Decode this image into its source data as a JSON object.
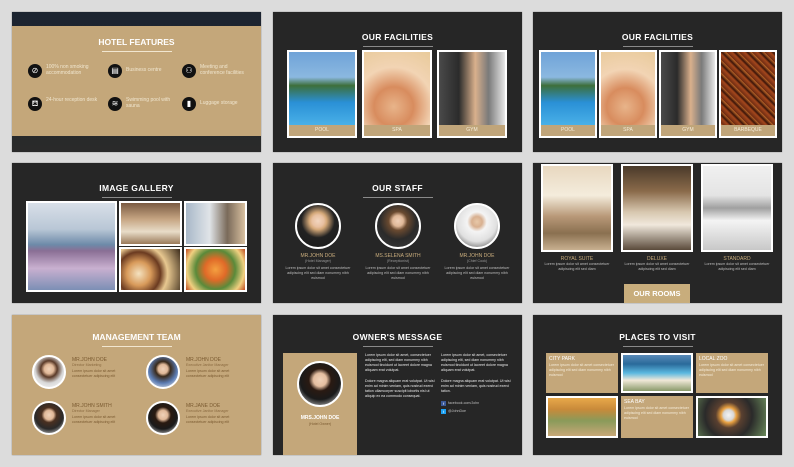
{
  "s1": {
    "title": "HOTEL FEATURES",
    "features": [
      {
        "icon": "no-smoking-icon",
        "glyph": "⊘",
        "label": "100% non smoking accommodation"
      },
      {
        "icon": "business-icon",
        "glyph": "▤",
        "label": "Business centre"
      },
      {
        "icon": "meeting-icon",
        "glyph": "⚇",
        "label": "Meeting and conference facilities"
      },
      {
        "icon": "reception-icon",
        "glyph": "⛾",
        "label": "24-hour reception desk"
      },
      {
        "icon": "pool-icon",
        "glyph": "≋",
        "label": "Swimming pool with sauna"
      },
      {
        "icon": "luggage-icon",
        "glyph": "▮",
        "label": "Luggage storage"
      }
    ]
  },
  "s2": {
    "title": "OUR FACILITIES",
    "items": [
      "POOL",
      "SPA",
      "GYM"
    ]
  },
  "s3": {
    "title": "OUR FACILITIES",
    "items": [
      "POOL",
      "SPA",
      "GYM",
      "BARBEQUE"
    ]
  },
  "s4": {
    "title": "IMAGE GALLERY"
  },
  "s5": {
    "title": "OUR STAFF",
    "staff": [
      {
        "name": "MR.JOHN DOE",
        "role": "(Hotel Manager)"
      },
      {
        "name": "MS.SELENA SMITH",
        "role": "(Receptionist)"
      },
      {
        "name": "MR.JOHN DOE",
        "role": "(Chief Cook)"
      }
    ],
    "desc": "Lorem ipsum dolor sit amet consectetuer adipiscing elit sed diam nonummy nibh euismod"
  },
  "s6": {
    "rooms": [
      "ROYAL SUITE",
      "DELUXE",
      "STANDARD"
    ],
    "desc": "Lorem ipsum dolor sit amet consectetuer adipiscing elit sed diam",
    "button": "OUR ROOMS"
  },
  "s7": {
    "title": "MANAGEMENT TEAM",
    "team": [
      {
        "name": "MR.JOHN DOE",
        "role": "Director Marketing"
      },
      {
        "name": "MR.JOHN DOE",
        "role": "Executive Janitor Manager"
      },
      {
        "name": "MR.JOHN SMITH",
        "role": "Director Manager"
      },
      {
        "name": "MR.JANE DOE",
        "role": "Executive Janitor Manager"
      }
    ],
    "desc": "Lorem ipsum dolor sit amet consectetuer adipiscing elit"
  },
  "s8": {
    "title": "OWNER'S MESSAGE",
    "name": "MRS.JOHN DOE",
    "role": "(Hotel Owner)",
    "p1": "Lorem ipsum dolor sit amet, consectetuer adipiscing elit, sed diam nonummy nibh euismod tincidunt ut laoreet dolore magna aliquam erat volutpat.",
    "p2": "Dolore magna aliquam erat volutpat. Ut wisi enim ad minim veniam, quis nostrud exerci tation ullamcorper suscipit lobortis nisl ut aliquip ex ea commodo consequat.",
    "p3": "Lorem ipsum dolor sit amet, consectetuer adipiscing elit, sed diam nonummy nibh euismod tincidunt ut laoreet dolore magna aliquam erat volutpat.",
    "p4": "Dolore magna aliquam erat volutpat. Ut wisi enim ad minim veniam, quis nostrud exerci tation.",
    "fb": "facebook.com/John",
    "tw": "@JohnDoe"
  },
  "s9": {
    "title": "PLACES TO VISIT",
    "places": [
      "CITY PARK",
      "LOCAL ZOO",
      "SEA BAY"
    ],
    "desc": "Lorem ipsum dolor sit amet consectetuer adipiscing elit sed diam nonummy nibh euismod"
  }
}
